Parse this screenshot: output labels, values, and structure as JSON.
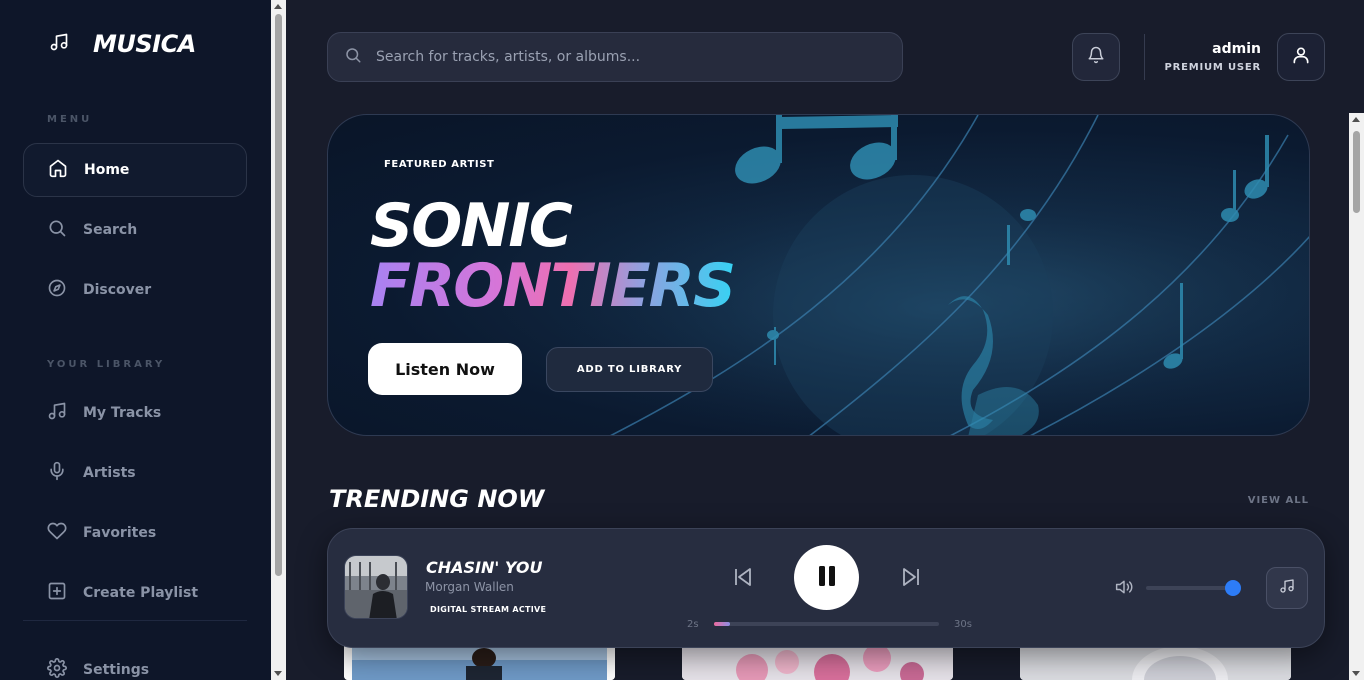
{
  "app": {
    "name": "MUSICA"
  },
  "sidebar": {
    "menu_title": "MENU",
    "menu_items": [
      {
        "label": "Home",
        "icon": "home-icon",
        "active": true
      },
      {
        "label": "Search",
        "icon": "search-icon"
      },
      {
        "label": "Discover",
        "icon": "compass-icon"
      }
    ],
    "library_title": "YOUR LIBRARY",
    "library_items": [
      {
        "label": "My Tracks",
        "icon": "music-note-icon"
      },
      {
        "label": "Artists",
        "icon": "microphone-icon"
      },
      {
        "label": "Favorites",
        "icon": "heart-icon"
      },
      {
        "label": "Create Playlist",
        "icon": "plus-square-icon"
      }
    ],
    "settings_label": "Settings"
  },
  "header": {
    "search_placeholder": "Search for tracks, artists, or albums...",
    "user_name": "admin",
    "user_tier": "PREMIUM USER"
  },
  "hero": {
    "tag": "FEATURED ARTIST",
    "title_line1": "SONIC",
    "title_line2": "FRONTIERS",
    "primary_button": "Listen Now",
    "secondary_button": "ADD TO LIBRARY"
  },
  "trending": {
    "title": "TRENDING NOW",
    "view_all": "VIEW ALL"
  },
  "player": {
    "track_title": "CHASIN' YOU",
    "artist": "Morgan Wallen",
    "status_badge": "DIGITAL STREAM ACTIVE",
    "time_current": "2s",
    "time_total": "30s",
    "progress_fraction": 0.07,
    "volume_fraction": 0.97
  },
  "colors": {
    "sidebar_bg": "#0e1629",
    "main_bg": "#181c2b",
    "accent_blue": "#2d7cf6",
    "gradient_start": "#a882f2",
    "gradient_end": "#37d2f3"
  }
}
